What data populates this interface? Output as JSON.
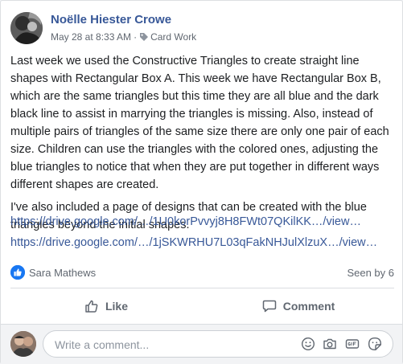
{
  "post": {
    "author": "Noëlle Hiester Crowe",
    "date": "May 28 at 8:33 AM",
    "separator": "·",
    "category": "Card Work",
    "paragraphs": [
      "Last week we used the Constructive Triangles to create straight line shapes with Rectangular Box A. This week we have Rectangular Box B, which are the same triangles but this time they are all blue and the dark black line to assist in marrying the triangles is missing. Also, instead of multiple pairs of triangles of the same size there are only one pair of each size. Children can use the triangles with the colored ones, adjusting the blue triangles to notice that when they are put together in different ways different shapes are created.",
      "I've also included a page of designs that can be created with the blue triangles beyond the initial shapes."
    ],
    "links": [
      "https://drive.google.com/…/1U0korPvvyj8H8FWt07QKilKK…/view…",
      "https://drive.google.com/…/1jSKWRHU7L03qFakNHJulXlzuX…/view…"
    ]
  },
  "reactions": {
    "icon": "like-icon",
    "reactor": "Sara Mathews",
    "seen": "Seen by 6"
  },
  "actions": {
    "like_label": "Like",
    "comment_label": "Comment"
  },
  "comment_bar": {
    "placeholder": "Write a comment...",
    "icons": [
      "emoji-icon",
      "camera-icon",
      "gif-icon",
      "sticker-icon"
    ]
  },
  "colors": {
    "link": "#385898",
    "accent": "#1877f2",
    "text": "#1c1e21",
    "secondary": "#606770"
  }
}
